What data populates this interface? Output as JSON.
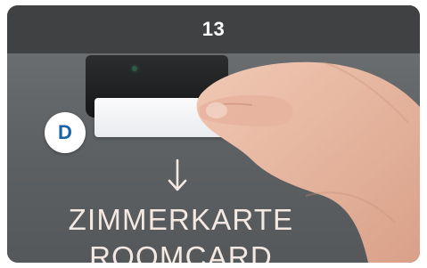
{
  "step": {
    "number": "13",
    "badge_letter": "D"
  },
  "sign": {
    "line1": "ZIMMERKARTE",
    "line2": "ROOMCARD"
  },
  "colors": {
    "header_bg": "#3f4142",
    "badge_text": "#1a63a8",
    "sign_text": "#f3e9e2"
  }
}
